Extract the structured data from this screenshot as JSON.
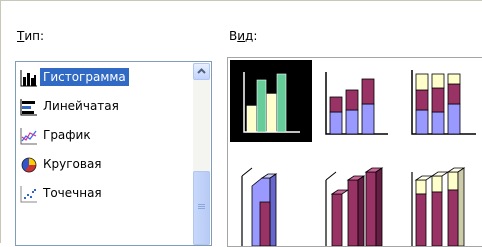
{
  "labels": {
    "type": "Тип:",
    "view": "Вид:"
  },
  "chart_types": [
    {
      "label": "Гистограмма",
      "icon": "column-chart-icon",
      "selected": true
    },
    {
      "label": "Линейчатая",
      "icon": "bar-chart-icon",
      "selected": false
    },
    {
      "label": "График",
      "icon": "line-chart-icon",
      "selected": false
    },
    {
      "label": "Круговая",
      "icon": "pie-chart-icon",
      "selected": false
    },
    {
      "label": "Точечная",
      "icon": "scatter-chart-icon",
      "selected": false
    }
  ],
  "subtypes": [
    {
      "icon": "clustered-column-icon",
      "selected": true
    },
    {
      "icon": "stacked-column-icon",
      "selected": false
    },
    {
      "icon": "percent-stacked-column-icon",
      "selected": false
    },
    {
      "icon": "clustered-column-3d-icon",
      "selected": false
    },
    {
      "icon": "stacked-column-3d-icon",
      "selected": false
    },
    {
      "icon": "percent-stacked-column-3d-icon",
      "selected": false
    }
  ],
  "colors": {
    "selection": "#316ac5",
    "series_purple": "#993366",
    "series_blue": "#9999ff",
    "series_yellow": "#ffffcc",
    "series_green": "#66cc99"
  }
}
